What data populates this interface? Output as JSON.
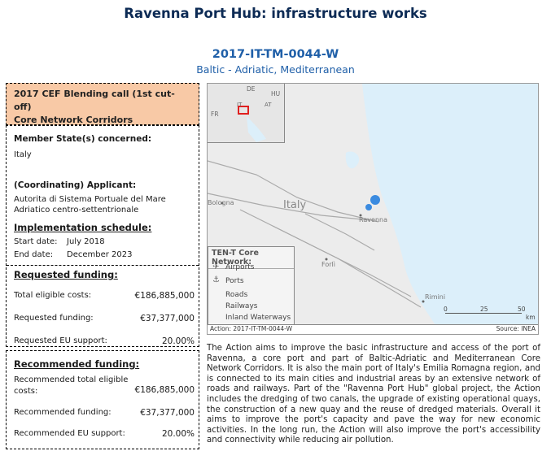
{
  "header": {
    "title": "Ravenna Port Hub: infrastructure works",
    "code": "2017-IT-TM-0044-W",
    "corridors": "Baltic - Adriatic, Mediterranean"
  },
  "call": {
    "line1": "2017 CEF Blending call (1st cut-off)",
    "line2": "Core Network Corridors"
  },
  "member_state": {
    "label": "Member State(s) concerned:",
    "value": "Italy"
  },
  "applicant": {
    "label": "(Coordinating) Applicant:",
    "line1": "Autorita di Sistema Portuale del Mare",
    "line2": "Adriatico centro-settentrionale"
  },
  "schedule": {
    "label": "Implementation schedule:",
    "start_label": "Start date:",
    "start_value": "July 2018",
    "end_label": "End date:",
    "end_value": "December 2023"
  },
  "requested": {
    "label": "Requested funding:",
    "rows": [
      {
        "label": "Total eligible costs:",
        "value": "€186,885,000"
      },
      {
        "label": "Requested funding:",
        "value": "€37,377,000"
      },
      {
        "label": "Requested EU support:",
        "value": "20.00%"
      }
    ]
  },
  "recommended": {
    "label": "Recommended funding:",
    "row1_label_a": "Recommended total eligible",
    "row1_label_b": "costs:",
    "row1_value": "€186,885,000",
    "row2_label": "Recommended funding:",
    "row2_value": "€37,377,000",
    "row3_label": "Recommended EU support:",
    "row3_value": "20.00%"
  },
  "map": {
    "inset_labels": {
      "de": "DE",
      "hu": "HU",
      "fr": "FR",
      "it": "IT",
      "at": "AT"
    },
    "country_label": "Italy",
    "cities": {
      "bologna": "Bologna",
      "ravenna": "Ravenna",
      "forli": "Forlì",
      "rimini": "Rimini"
    },
    "legend": {
      "title": "TEN-T Core Network:",
      "airports": "Airports",
      "ports": "Ports",
      "roads": "Roads",
      "railways": "Railways",
      "waterways": "Inland Waterways"
    },
    "scale": {
      "t0": "0",
      "t1": "25",
      "t2": "50",
      "unit": "km"
    },
    "footer_left": "Action: 2017-IT-TM-0044-W",
    "footer_right": "Source: INEA",
    "colors": {
      "sea": "#dceffa",
      "land": "#ececec",
      "port": "#3b8be0",
      "highlight": "#e02020"
    }
  },
  "description": "The Action aims to improve the basic infrastructure and access of the port of Ravenna, a core port and part of Baltic-Adriatic and Mediterranean Core Network Corridors. It is also the main port of Italy's Emilia Romagna region, and is connected to its main cities and industrial areas by an extensive network of roads and railways. Part of the \"Ravenna Port Hub\" global project, the Action includes the dredging of two canals, the upgrade of existing operational quays, the construction of a new quay and the reuse of dredged materials. Overall it aims to improve the port's capacity and pave the way for new economic activities. In the long run, the Action will also improve the port's accessibility and connectivity while reducing air pollution."
}
